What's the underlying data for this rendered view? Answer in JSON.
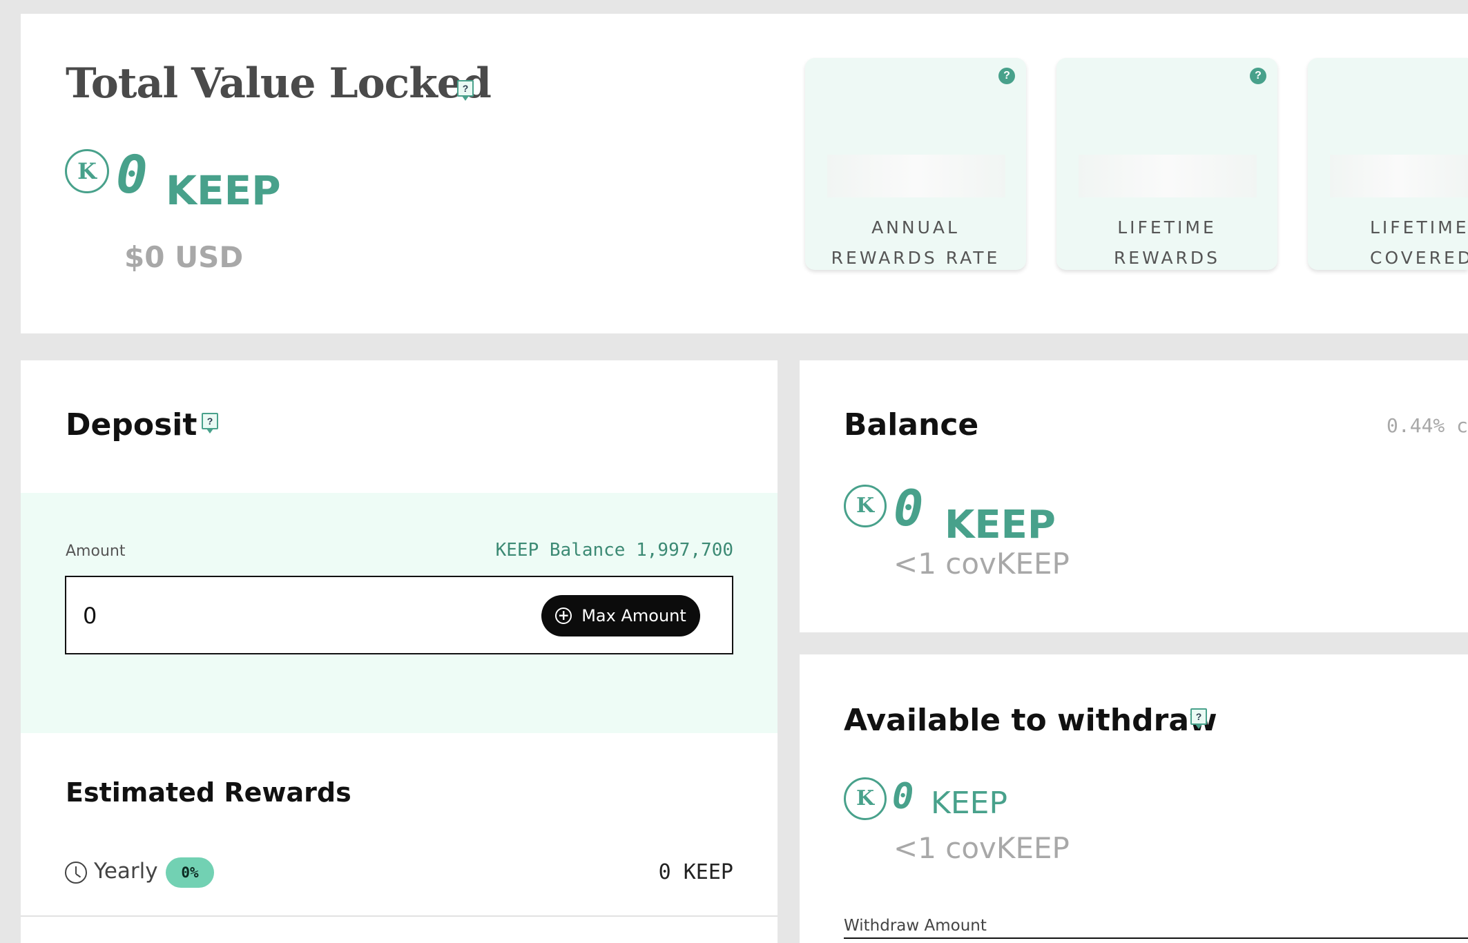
{
  "tvl": {
    "title": "Total Value Locked",
    "help": "?",
    "coin_glyph": "K",
    "amount": "0",
    "token": "KEEP",
    "usd": "$0 USD",
    "stats": [
      {
        "line1": "ANNUAL",
        "line2": "REWARDS RATE",
        "help": "?"
      },
      {
        "line1": "LIFETIME",
        "line2": "REWARDS",
        "help": "?"
      },
      {
        "line1": "LIFETIME",
        "line2": "COVERED"
      }
    ]
  },
  "deposit": {
    "title": "Deposit",
    "help": "?",
    "amount_label": "Amount",
    "balance_label": "KEEP Balance 1,997,700",
    "amount_value": "0",
    "max_button": "Max Amount",
    "plus_glyph": "+",
    "estimated_title": "Estimated Rewards",
    "yearly_label": "Yearly",
    "yearly_rate": "0%",
    "yearly_value": "0 KEEP"
  },
  "balance": {
    "title": "Balance",
    "meta": "0.44% c",
    "coin_glyph": "K",
    "amount": "0",
    "token": "KEEP",
    "cov": "<1 covKEEP"
  },
  "withdraw": {
    "title": "Available to withdraw",
    "help": "?",
    "coin_glyph": "K",
    "amount": "0",
    "token": "KEEP",
    "cov": "<1 covKEEP",
    "amount_label": "Withdraw Amount"
  },
  "colors": {
    "accent": "#48a18b",
    "band": "#eefcf6",
    "badge": "#72d1b3"
  }
}
